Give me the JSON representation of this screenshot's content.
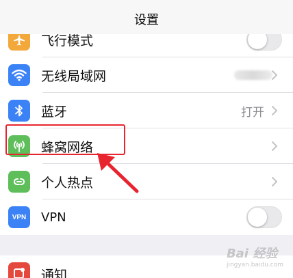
{
  "nav": {
    "title": "设置"
  },
  "rows": [
    {
      "id": "airplane",
      "label": "飞行模式",
      "icon": "airplane-icon",
      "color": "#f3a83b",
      "control": "toggle",
      "toggle_on": false
    },
    {
      "id": "wifi",
      "label": "无线局域网",
      "icon": "wifi-icon",
      "color": "#3b82f6",
      "control": "chevron",
      "value_blurred": true
    },
    {
      "id": "bluetooth",
      "label": "蓝牙",
      "icon": "bluetooth-icon",
      "color": "#3b82f6",
      "control": "chevron",
      "value": "打开"
    },
    {
      "id": "cellular",
      "label": "蜂窝网络",
      "icon": "cellular-antenna-icon",
      "color": "#5dbe5a",
      "control": "chevron",
      "highlighted": true
    },
    {
      "id": "hotspot",
      "label": "个人热点",
      "icon": "hotspot-link-icon",
      "color": "#5dbe5a",
      "control": "chevron"
    },
    {
      "id": "vpn",
      "label": "VPN",
      "icon": "vpn-badge-icon",
      "icon_text": "VPN",
      "color": "#3b82f6",
      "control": "toggle",
      "toggle_on": false
    }
  ],
  "group2": [
    {
      "id": "notifications",
      "label": "通知",
      "icon": "notifications-icon",
      "color": "#e5483d"
    }
  ],
  "annotation": {
    "color": "#e8242f"
  },
  "watermark": {
    "text": "Bai 经验",
    "sub": "jingyan.baidu.com"
  }
}
